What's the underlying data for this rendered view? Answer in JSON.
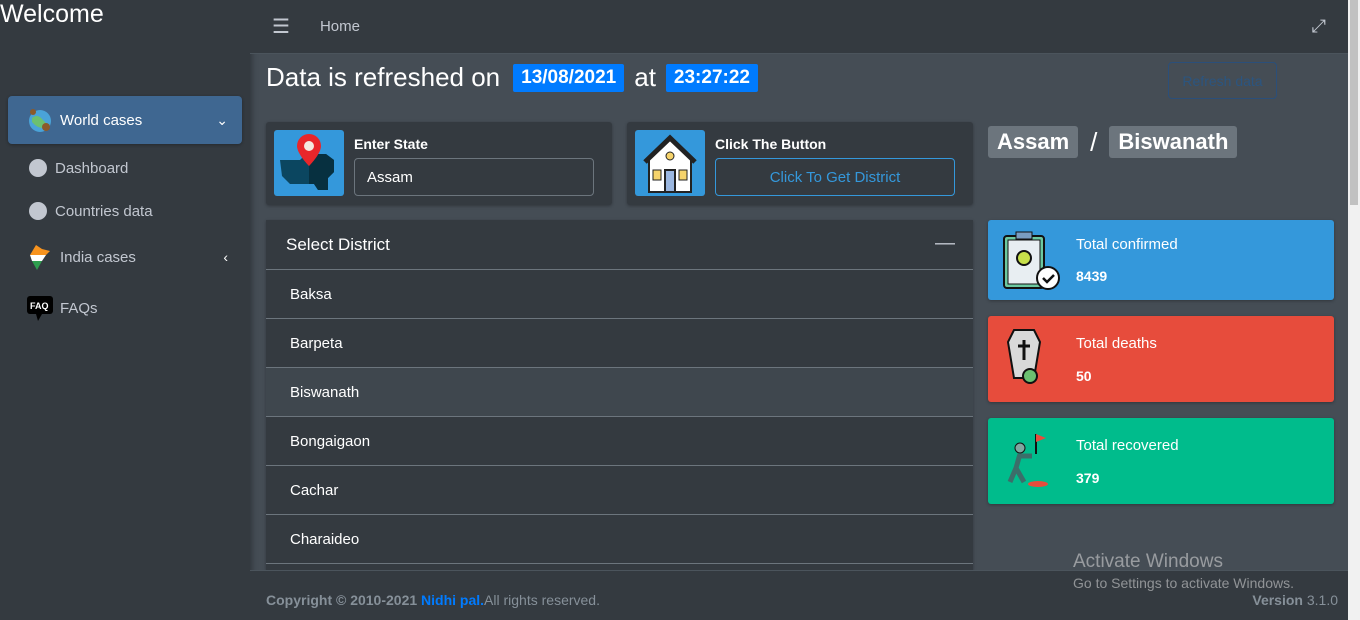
{
  "sidebar": {
    "brand": "Welcome",
    "items": [
      {
        "label": "World cases",
        "icon": "globe-virus-icon"
      },
      {
        "label": "Dashboard",
        "icon": "circle-icon"
      },
      {
        "label": "Countries data",
        "icon": "circle-icon"
      },
      {
        "label": "India cases",
        "icon": "india-map-icon"
      },
      {
        "label": "FAQs",
        "icon": "faq-icon"
      }
    ]
  },
  "topbar": {
    "home": "Home"
  },
  "header": {
    "prefix": "Data is refreshed on",
    "date": "13/08/2021",
    "at": "at",
    "time": "23:27:22",
    "refresh_label": "Refresh data"
  },
  "state_card": {
    "label": "Enter State",
    "value": "Assam"
  },
  "button_card": {
    "label": "Click The Button",
    "button": "Click To Get District"
  },
  "location": {
    "state": "Assam",
    "sep": "/",
    "district": "Biswanath"
  },
  "district_list": {
    "title": "Select District",
    "items": [
      "Baksa",
      "Barpeta",
      "Biswanath",
      "Bongaigaon",
      "Cachar",
      "Charaideo"
    ]
  },
  "stats": [
    {
      "label": "Total confirmed",
      "value": "8439",
      "color": "#3498db"
    },
    {
      "label": "Total deaths",
      "value": "50",
      "color": "#e74c3c"
    },
    {
      "label": "Total recovered",
      "value": "379",
      "color": "#00bc8c"
    }
  ],
  "footer": {
    "copy": "Copyright © 2010-2021",
    "author": "Nidhi pal.",
    "rights": "All rights reserved.",
    "version_label": "Version",
    "version": "3.1.0"
  },
  "watermark": {
    "title": "Activate Windows",
    "sub": "Go to Settings to activate Windows."
  }
}
